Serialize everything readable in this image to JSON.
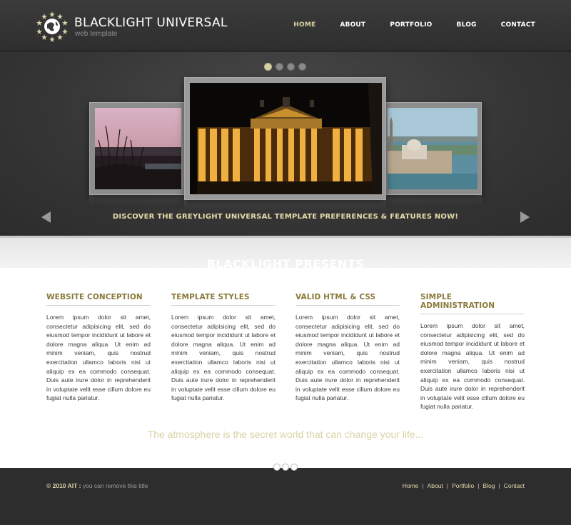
{
  "header": {
    "logo_title": "BLACKLIGHT UNIVERSAL",
    "logo_subtitle": "web template",
    "nav": [
      {
        "label": "HOME",
        "active": true
      },
      {
        "label": "ABOUT",
        "active": false
      },
      {
        "label": "PORTFOLIO",
        "active": false
      },
      {
        "label": "BLOG",
        "active": false
      },
      {
        "label": "CONTACT",
        "active": false
      }
    ]
  },
  "slider": {
    "dots_count": 4,
    "active_dot": 1,
    "caption": "DISCOVER THE GREYLIGHT UNIVERSAL TEMPLATE PREFERENCES & FEATURES NOW!",
    "slides": [
      "sunset-lake-photo",
      "illuminated-building-photo",
      "venice-coast-photo"
    ]
  },
  "presents": {
    "title": "BLACKLIGHT PRESENTS"
  },
  "columns": [
    {
      "heading": "WEBSITE CONCEPTION",
      "text": "Lorem ipsum dolor sit amet, consectetur adipisicing elit, sed do eiusmod tempor incididunt ut labore et dolore magna aliqua. Ut enim ad minim veniam, quis nostrud exercitation ullamco laboris nisi ut aliquip ex ea commodo consequat. Duis aute irure dolor in reprehenderit in voluptate velit esse cillum dolore eu fugiat nulla pariatur."
    },
    {
      "heading": "TEMPLATE STYLES",
      "text": "Lorem ipsum dolor sit amet, consectetur adipisicing elit, sed do eiusmod tempor incididunt ut labore et dolore magna aliqua. Ut enim ad minim veniam, quis nostrud exercitation ullamco laboris nisi ut aliquip ex ea commodo consequat. Duis aute irure dolor in reprehenderit in voluptate velit esse cillum dolore eu fugiat nulla pariatur."
    },
    {
      "heading": "VALID HTML & CSS",
      "text": "Lorem ipsum dolor sit amet, consectetur adipisicing elit, sed do eiusmod tempor incididunt ut labore et dolore magna aliqua. Ut enim ad minim veniam, quis nostrud exercitation ullamco laboris nisi ut aliquip ex ea commodo consequat. Duis aute irure dolor in reprehenderit in voluptate velit esse cillum dolore eu fugiat nulla pariatur."
    },
    {
      "heading": "SIMPLE ADMINISTRATION",
      "text": "Lorem ipsum dolor sit amet, consectetur adipisicing elit, sed do eiusmod tempor incididunt ut labore et dolore magna aliqua. Ut enim ad minim veniam, quis nostrud exercitation ullamco laboris nisi ut aliquip ex ea commodo consequat. Duis aute irure dolor in reprehenderit in voluptate velit esse cillum dolore eu fugiat nulla pariatur."
    }
  ],
  "tagline": "The atmosphere is the secret world that can change your life...",
  "footer": {
    "copyright_year": "© 2010 AIT :",
    "copyright_note": "you can remove this title",
    "links": [
      "Home",
      "About",
      "Portfolio",
      "Blog",
      "Contact"
    ]
  },
  "colors": {
    "accent_gold": "#d8d2a4",
    "heading_olive": "#8a7a3a",
    "background_dark": "#2d2d2d"
  }
}
